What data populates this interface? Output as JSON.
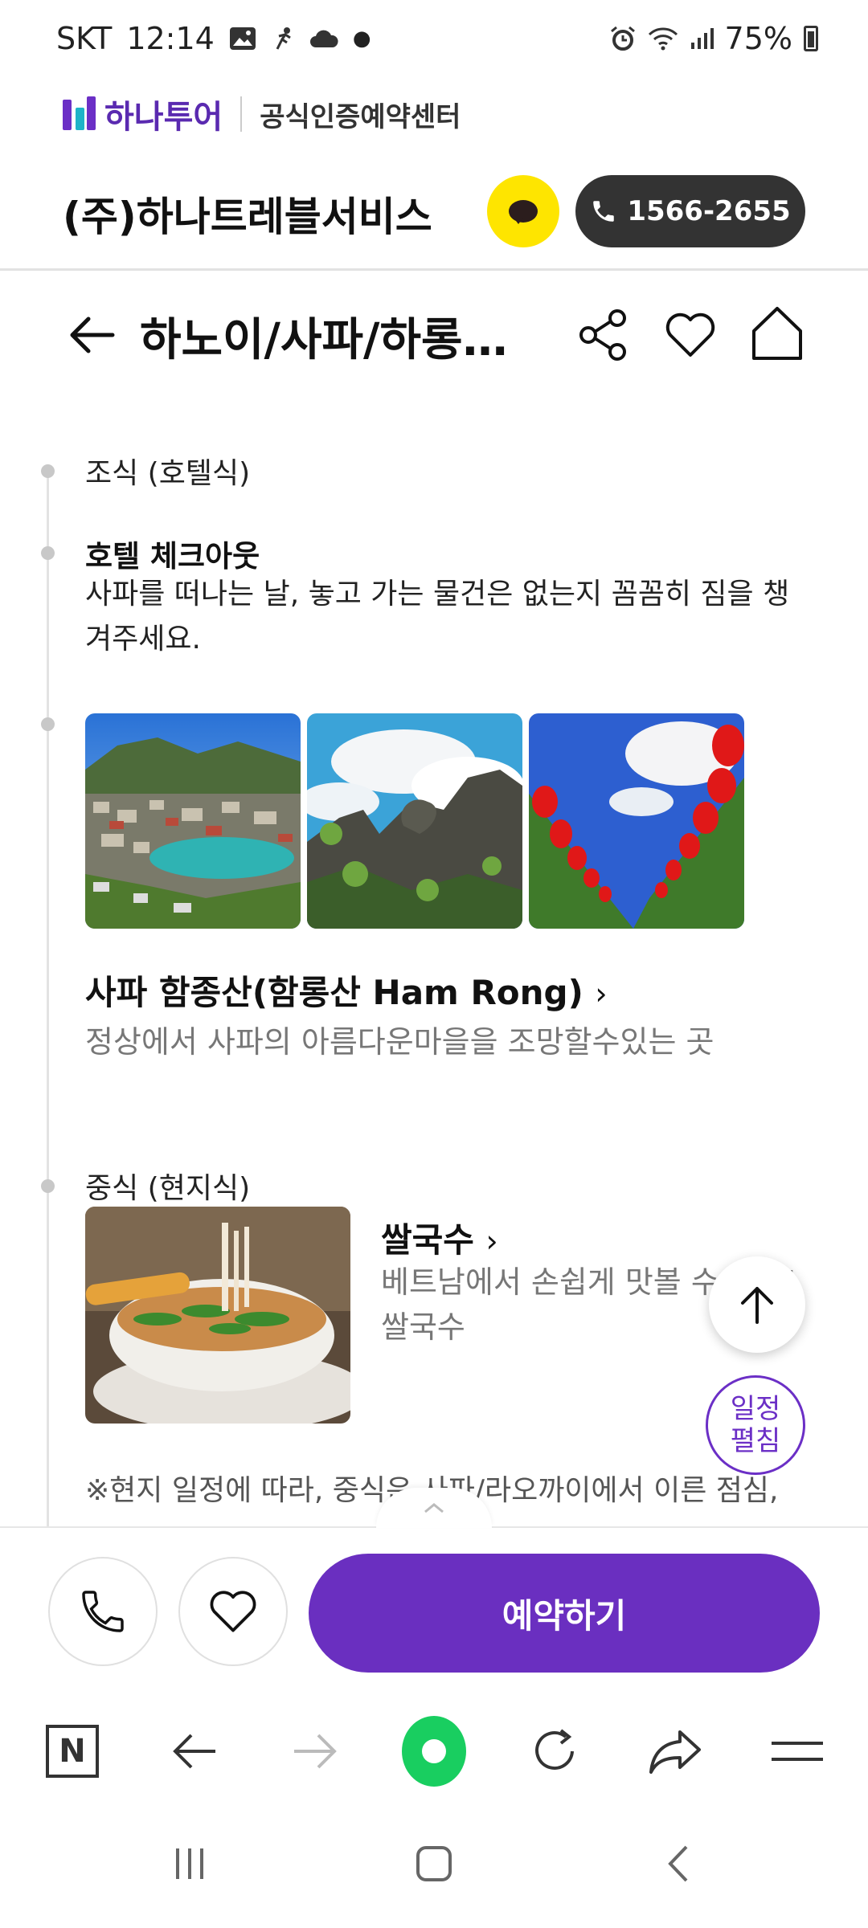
{
  "status_bar": {
    "carrier": "SKT",
    "time": "12:14",
    "battery": "75%"
  },
  "brand": {
    "logo_text": "하나투어",
    "certified_label": "공식인증예약센터"
  },
  "agency": {
    "name": "(주)하나트레블서비스",
    "phone": "1566-2655"
  },
  "header": {
    "title": "하노이/사파/하롱베..."
  },
  "timeline": {
    "breakfast": "조식 (호텔식)",
    "checkout_title": "호텔 체크아웃",
    "checkout_desc": "사파를 떠나는 날, 놓고 가는 물건은 없는지 꼼꼼히 짐을 챙겨주세요.",
    "place_title": "사파 함종산(함롱산 Ham Rong)",
    "place_desc": "정상에서 사파의 아름다운마을을 조망할수있는 곳",
    "lunch": "중식 (현지식)",
    "food_title": "쌀국수",
    "food_desc": "베트남에서 손쉽게 맛볼 수 있는! 쌀국수",
    "note": "※현지 일정에 따라, 중식은 사파/라오까이에서 이른 점심,"
  },
  "floating": {
    "schedule_toggle": "일정\n펼침"
  },
  "action_bar": {
    "book_label": "예약하기"
  },
  "browser_toolbar": {
    "tab_icon_letter": "N"
  }
}
